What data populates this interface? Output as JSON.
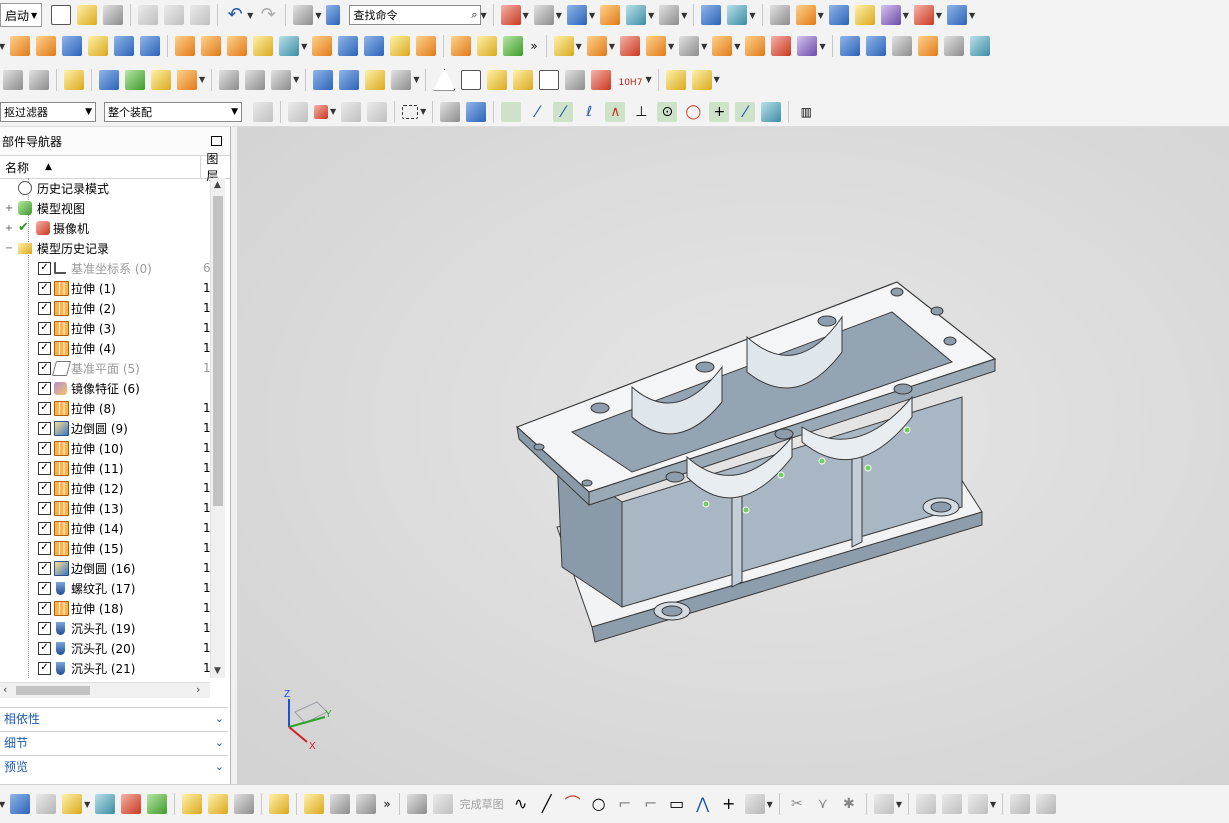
{
  "toolbar": {
    "start_label": "启动",
    "search_placeholder": "查找命令",
    "tolerance_label": "10H7",
    "overflow_glyph": "»"
  },
  "selection_bar": {
    "filter_value": "抠过滤器",
    "scope_value": "整个装配"
  },
  "navigator": {
    "title": "部件导航器",
    "col_name": "名称",
    "col_layer": "图层",
    "top_items": [
      {
        "label": "历史记录模式",
        "icon": "clock-icon"
      },
      {
        "label": "模型视图",
        "icon": "views-icon"
      },
      {
        "label": "摄像机",
        "icon": "camera-icon"
      },
      {
        "label": "模型历史记录",
        "icon": "folder-icon"
      }
    ],
    "features": [
      {
        "label": "基准坐标系 (0)",
        "layer": "6",
        "icon": "csys-icon",
        "gray": true
      },
      {
        "label": "拉伸 (1)",
        "layer": "1",
        "icon": "extrude-icon",
        "gray": false
      },
      {
        "label": "拉伸 (2)",
        "layer": "1",
        "icon": "extrude-icon",
        "gray": false
      },
      {
        "label": "拉伸 (3)",
        "layer": "1",
        "icon": "extrude-icon",
        "gray": false
      },
      {
        "label": "拉伸 (4)",
        "layer": "1",
        "icon": "extrude-icon",
        "gray": false
      },
      {
        "label": "基准平面 (5)",
        "layer": "1",
        "icon": "datum-plane-icon",
        "gray": true
      },
      {
        "label": "镜像特征 (6)",
        "layer": "",
        "icon": "mirror-icon",
        "gray": false
      },
      {
        "label": "拉伸 (8)",
        "layer": "1",
        "icon": "extrude-icon",
        "gray": false
      },
      {
        "label": "边倒圆 (9)",
        "layer": "1",
        "icon": "edge-blend-icon",
        "gray": false
      },
      {
        "label": "拉伸 (10)",
        "layer": "1",
        "icon": "extrude-icon",
        "gray": false
      },
      {
        "label": "拉伸 (11)",
        "layer": "1",
        "icon": "extrude-icon",
        "gray": false
      },
      {
        "label": "拉伸 (12)",
        "layer": "1",
        "icon": "extrude-icon",
        "gray": false
      },
      {
        "label": "拉伸 (13)",
        "layer": "1",
        "icon": "extrude-icon",
        "gray": false
      },
      {
        "label": "拉伸 (14)",
        "layer": "1",
        "icon": "extrude-icon",
        "gray": false
      },
      {
        "label": "拉伸 (15)",
        "layer": "1",
        "icon": "extrude-icon",
        "gray": false
      },
      {
        "label": "边倒圆 (16)",
        "layer": "1",
        "icon": "edge-blend-icon",
        "gray": false
      },
      {
        "label": "螺纹孔 (17)",
        "layer": "1",
        "icon": "threaded-hole-icon",
        "gray": false
      },
      {
        "label": "拉伸 (18)",
        "layer": "1",
        "icon": "extrude-icon",
        "gray": false
      },
      {
        "label": "沉头孔 (19)",
        "layer": "1",
        "icon": "counterbore-icon",
        "gray": false
      },
      {
        "label": "沉头孔 (20)",
        "layer": "1",
        "icon": "counterbore-icon",
        "gray": false
      },
      {
        "label": "沉头孔 (21)",
        "layer": "1",
        "icon": "counterbore-icon",
        "gray": false
      }
    ]
  },
  "panels": {
    "dependencies": "相依性",
    "details": "细节",
    "preview": "预览"
  },
  "triad": {
    "x": "X",
    "y": "Y",
    "z": "Z"
  },
  "bottom_toolbar": {
    "finish_sketch": "完成草图"
  },
  "colors": {
    "model_face": "#a9b7c4",
    "model_top": "#f4f5f6",
    "viewport_bg": "#dadada",
    "accent_blue": "#1e5bb0"
  }
}
